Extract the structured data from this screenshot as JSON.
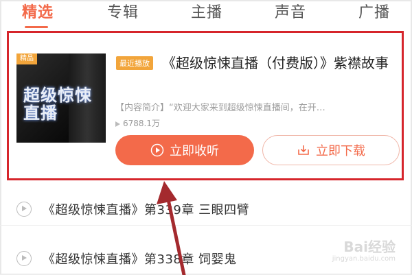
{
  "tabs": [
    {
      "label": "精选"
    },
    {
      "label": "专辑"
    },
    {
      "label": "主播"
    },
    {
      "label": "声音"
    },
    {
      "label": "广播"
    }
  ],
  "active_tab": "精选",
  "album": {
    "cover_badge": "精品",
    "cover_title": "超级惊悚直播",
    "recent_tag": "最近播放",
    "title": "《超级惊悚直播（付费版）》紫襟故事",
    "description": "【内容简介】“欢迎大家来到超级惊悚直播间，在开…",
    "plays": "6788.1万",
    "listen_label": "立即收听",
    "download_label": "立即下载"
  },
  "episodes": [
    {
      "title": "《超级惊悚直播》第339章 三眼四臂"
    },
    {
      "title": "《超级惊悚直播》第338章 饲婴鬼"
    }
  ],
  "colors": {
    "accent": "#f36a4a",
    "highlight_box": "#d6252b",
    "tag": "#f2a53b",
    "arrow": "#a42a2e"
  },
  "watermark": {
    "brand": "Bai经验",
    "url": "jingyan.baidu.com"
  }
}
